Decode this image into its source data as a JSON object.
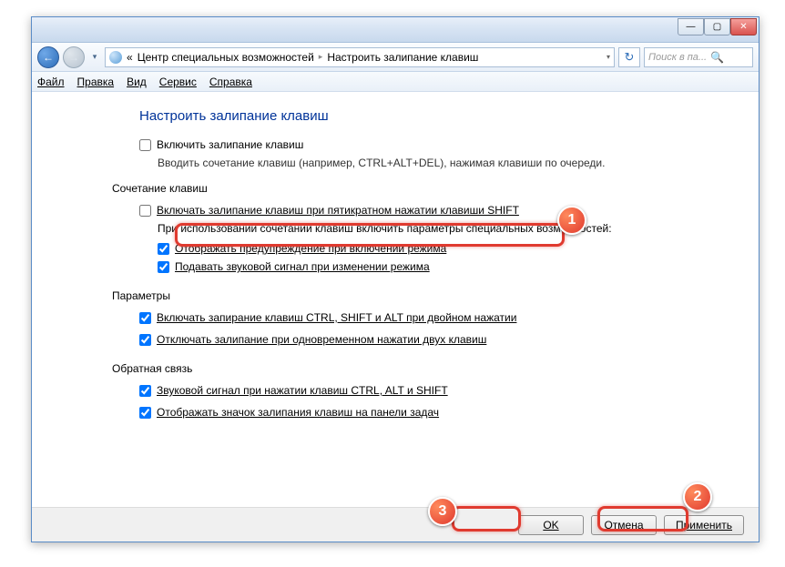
{
  "titlebar": {
    "minimize": "—",
    "maximize": "▢",
    "close": "✕"
  },
  "nav": {
    "back": "←",
    "forward": "→",
    "dropdown": "▾",
    "chevrons": "«",
    "crumb1": "Центр специальных возможностей",
    "sep": "▸",
    "crumb2": "Настроить залипание клавиш",
    "crumbdrop": "▾",
    "refresh": "↻",
    "search_placeholder": "Поиск в па...",
    "search_icon": "🔍"
  },
  "menu": {
    "file": "Файл",
    "edit": "Правка",
    "view": "Вид",
    "tools": "Сервис",
    "help": "Справка"
  },
  "page": {
    "title": "Настроить залипание клавиш",
    "enable_label": "Включить залипание клавиш",
    "enable_desc": "Вводить сочетание клавиш (например, CTRL+ALT+DEL), нажимая клавиши по очереди.",
    "group_shortcut": "Сочетание клавиш",
    "shift5_label": "Включать залипание клавиш при пятикратном нажатии клавиши SHIFT",
    "shortcut_desc": "При использовании сочетаний клавиш включить параметры специальных возможностей:",
    "warn_label": "Отображать предупреждение при включении режима",
    "sound_label": "Подавать звуковой сигнал при изменении режима",
    "group_params": "Параметры",
    "lock_label": "Включать запирание клавиш CTRL, SHIFT и ALT при двойном нажатии",
    "off2_label": "Отключать залипание при одновременном нажатии двух клавиш",
    "group_feedback": "Обратная связь",
    "beep_label": "Звуковой сигнал при нажатии клавиш CTRL, ALT и SHIFT",
    "tray_label": "Отображать значок залипания клавиш на панели задач"
  },
  "footer": {
    "ok": "OK",
    "cancel": "Отмена",
    "apply": "Применить"
  },
  "badges": {
    "b1": "1",
    "b2": "2",
    "b3": "3"
  }
}
